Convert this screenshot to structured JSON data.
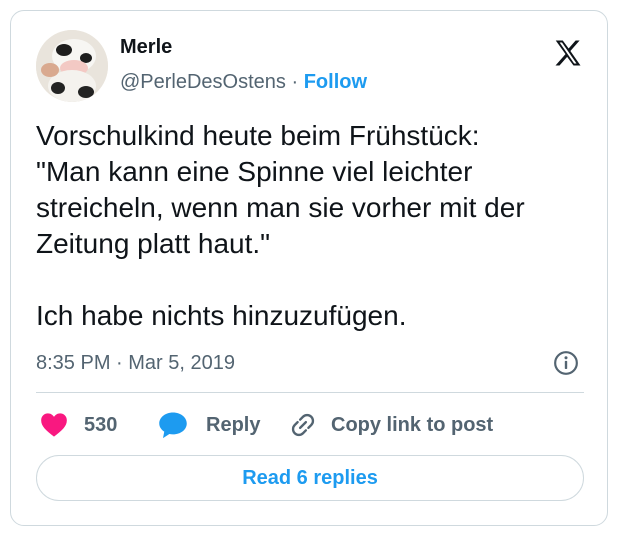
{
  "author": {
    "name": "Merle",
    "handle": "@PerleDesOstens",
    "separator": "·",
    "follow_label": "Follow"
  },
  "tweet": {
    "text": "Vorschulkind heute beim Frühstück:\n\"Man kann eine Spinne viel leichter streicheln, wenn man sie vorher mit der Zeitung platt haut.\"\n\nIch habe nichts hinzuzufügen.",
    "timestamp": "8:35 PM · Mar 5, 2019"
  },
  "actions": {
    "like_count": "530",
    "reply_label": "Reply",
    "copy_label": "Copy link to post"
  },
  "footer": {
    "read_replies_label": "Read 6 replies"
  },
  "icons": {
    "brand": "x-logo-icon",
    "info": "info-icon",
    "like": "heart-icon",
    "reply": "speech-bubble-icon",
    "copy": "link-icon"
  },
  "colors": {
    "accent": "#1d9bf0",
    "like": "#f91880",
    "text": "#0f1419",
    "secondary": "#536471",
    "border": "#cfd9de"
  }
}
